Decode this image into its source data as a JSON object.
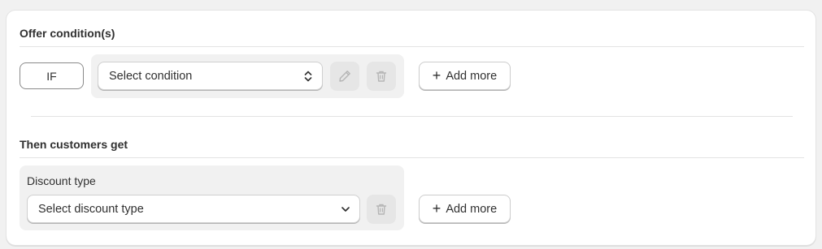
{
  "offer": {
    "title": "Offer condition(s)",
    "if_label": "IF",
    "condition_select": {
      "value": "Select condition"
    },
    "add_more_label": "Add more"
  },
  "then": {
    "title": "Then customers get",
    "discount_type_label": "Discount type",
    "discount_select": {
      "value": "Select discount type"
    },
    "add_more_label": "Add more"
  },
  "icons": {
    "edit": "pencil-icon",
    "delete": "trash-icon",
    "select_updown": "chevron-updown-icon",
    "select_down": "chevron-down-icon",
    "add": "plus-icon"
  },
  "colors": {
    "page_bg": "#f1f1f1",
    "card_bg": "#ffffff",
    "text": "#303030",
    "disabled_icon": "#b5b5b5"
  }
}
